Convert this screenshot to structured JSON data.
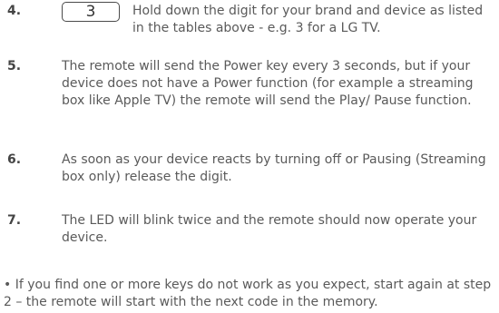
{
  "steps": [
    {
      "number": "4.",
      "key": "3",
      "text": "Hold down the digit for your brand and device as listed in the tables above - e.g. 3  for a LG TV."
    },
    {
      "number": "5.",
      "text": "The remote will send the Power key every 3 seconds,  but if your device does not have a Power function (for example a streaming box like Apple TV) the remote will send the Play/ Pause function."
    },
    {
      "number": "6.",
      "text": "As soon as your device reacts by turning off or Pausing (Streaming box only) release the digit."
    },
    {
      "number": "7.",
      "text": "The LED will blink twice and the remote should now operate your device."
    }
  ],
  "note": "• If you find one or more keys do not work as you expect, start again at step 2 – the remote will start with the next code in the memory."
}
